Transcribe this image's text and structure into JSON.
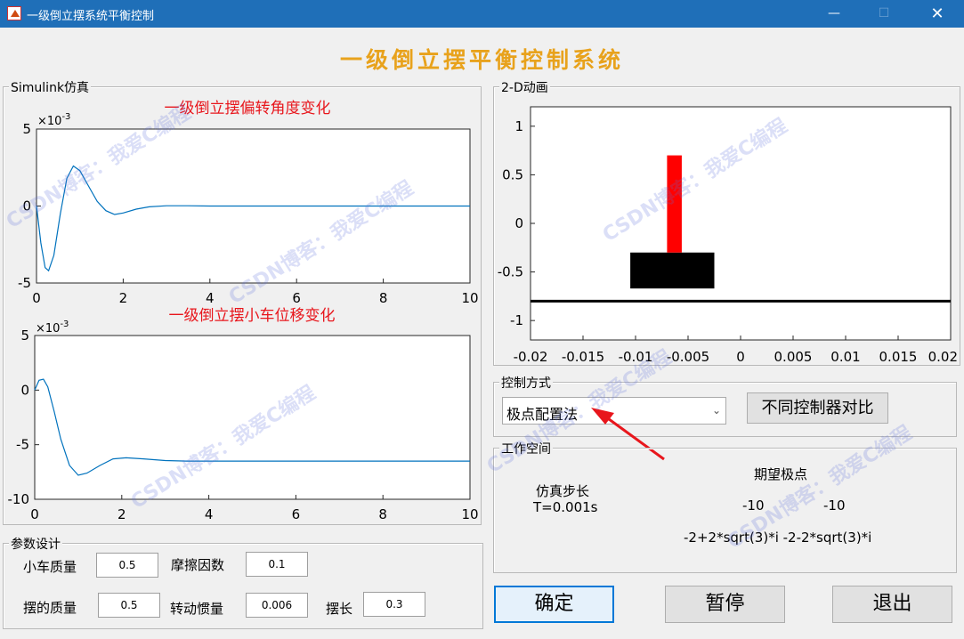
{
  "window": {
    "title": "一级倒立摆系统平衡控制",
    "minimize": "—",
    "maximize": "☐",
    "close": "✕"
  },
  "main_title": "一级倒立摆平衡控制系统",
  "simulink_panel": {
    "legend": "Simulink仿真",
    "plot1": {
      "title": "一级倒立摆偏转角度变化",
      "exponent_base": "×10",
      "exponent_power": "-3",
      "y_ticks": [
        "5",
        "0",
        "-5"
      ],
      "x_ticks": [
        "0",
        "2",
        "4",
        "6",
        "8",
        "10"
      ]
    },
    "plot2": {
      "title": "一级倒立摆小车位移变化",
      "exponent_base": "×10",
      "exponent_power": "-3",
      "y_ticks": [
        "5",
        "0",
        "-5",
        "-10"
      ],
      "x_ticks": [
        "0",
        "2",
        "4",
        "6",
        "8",
        "10"
      ]
    }
  },
  "anim_panel": {
    "legend": "2-D动画",
    "y_ticks": [
      "1",
      "0.5",
      "0",
      "-0.5",
      "-1"
    ],
    "x_ticks": [
      "-0.02",
      "-0.015",
      "-0.01",
      "-0.005",
      "0",
      "0.005",
      "0.01",
      "0.015",
      "0.02"
    ]
  },
  "params_panel": {
    "legend": "参数设计",
    "cart_mass_label": "小车质量",
    "cart_mass_value": "0.5",
    "friction_label": "摩擦因数",
    "friction_value": "0.1",
    "pendulum_mass_label": "摆的质量",
    "pendulum_mass_value": "0.5",
    "inertia_label": "转动惯量",
    "inertia_value": "0.006",
    "length_label": "摆长",
    "length_value": "0.3"
  },
  "control_panel": {
    "legend": "控制方式",
    "selected_method": "极点配置法",
    "compare_button": "不同控制器对比"
  },
  "workspace_panel": {
    "legend": "工作空间",
    "step_label": "仿真步长",
    "step_value": "T=0.001s",
    "poles_label": "期望极点",
    "pole1": "-10",
    "pole2": "-10",
    "poles_complex": "-2+2*sqrt(3)*i -2-2*sqrt(3)*i"
  },
  "buttons": {
    "confirm": "确定",
    "pause": "暂停",
    "exit": "退出"
  },
  "watermark": "CSDN博客：我爱C编程",
  "chart_data": [
    {
      "type": "line",
      "title": "一级倒立摆偏转角度变化",
      "xlim": [
        0,
        10
      ],
      "ylim": [
        -5,
        5
      ],
      "y_scale_note": "×10^-3",
      "series": [
        {
          "color": "#0072bd",
          "x": [
            0,
            0.1,
            0.2,
            0.28,
            0.4,
            0.55,
            0.7,
            0.85,
            1.0,
            1.2,
            1.4,
            1.6,
            1.8,
            2.0,
            2.3,
            2.6,
            3.0,
            3.5,
            4,
            5,
            6,
            7,
            8,
            9,
            10
          ],
          "y": [
            0,
            -2.4,
            -4.0,
            -4.2,
            -3.2,
            -0.5,
            1.8,
            2.6,
            2.3,
            1.3,
            0.3,
            -0.3,
            -0.55,
            -0.45,
            -0.2,
            -0.05,
            0.02,
            0.02,
            0,
            0,
            0,
            0,
            0,
            0,
            0
          ]
        }
      ]
    },
    {
      "type": "line",
      "title": "一级倒立摆小车位移变化",
      "xlim": [
        0,
        10
      ],
      "ylim": [
        -10,
        5
      ],
      "y_scale_note": "×10^-3",
      "series": [
        {
          "color": "#0072bd",
          "x": [
            0,
            0.1,
            0.2,
            0.3,
            0.45,
            0.6,
            0.8,
            1.0,
            1.2,
            1.5,
            1.8,
            2.1,
            2.5,
            3.0,
            3.5,
            4,
            5,
            6,
            7,
            8,
            9,
            10
          ],
          "y": [
            0,
            0.9,
            1.0,
            0.3,
            -2.0,
            -4.5,
            -6.9,
            -7.8,
            -7.6,
            -6.9,
            -6.3,
            -6.2,
            -6.3,
            -6.45,
            -6.5,
            -6.5,
            -6.5,
            -6.5,
            -6.5,
            -6.5,
            -6.5,
            -6.5
          ]
        }
      ]
    }
  ],
  "anim_data": {
    "xlim": [
      -0.02,
      0.02
    ],
    "ylim": [
      -1.2,
      1.2
    ],
    "ground_y": -0.8,
    "cart": {
      "x0": -0.0105,
      "x1": -0.0025,
      "y0": -0.67,
      "y1": -0.3
    },
    "pole": {
      "x0": -0.007,
      "x1": -0.0056,
      "y0": -0.3,
      "y1": 0.7
    },
    "cart_color": "#000000",
    "pole_color": "#ff0000",
    "ground_color": "#000000"
  }
}
